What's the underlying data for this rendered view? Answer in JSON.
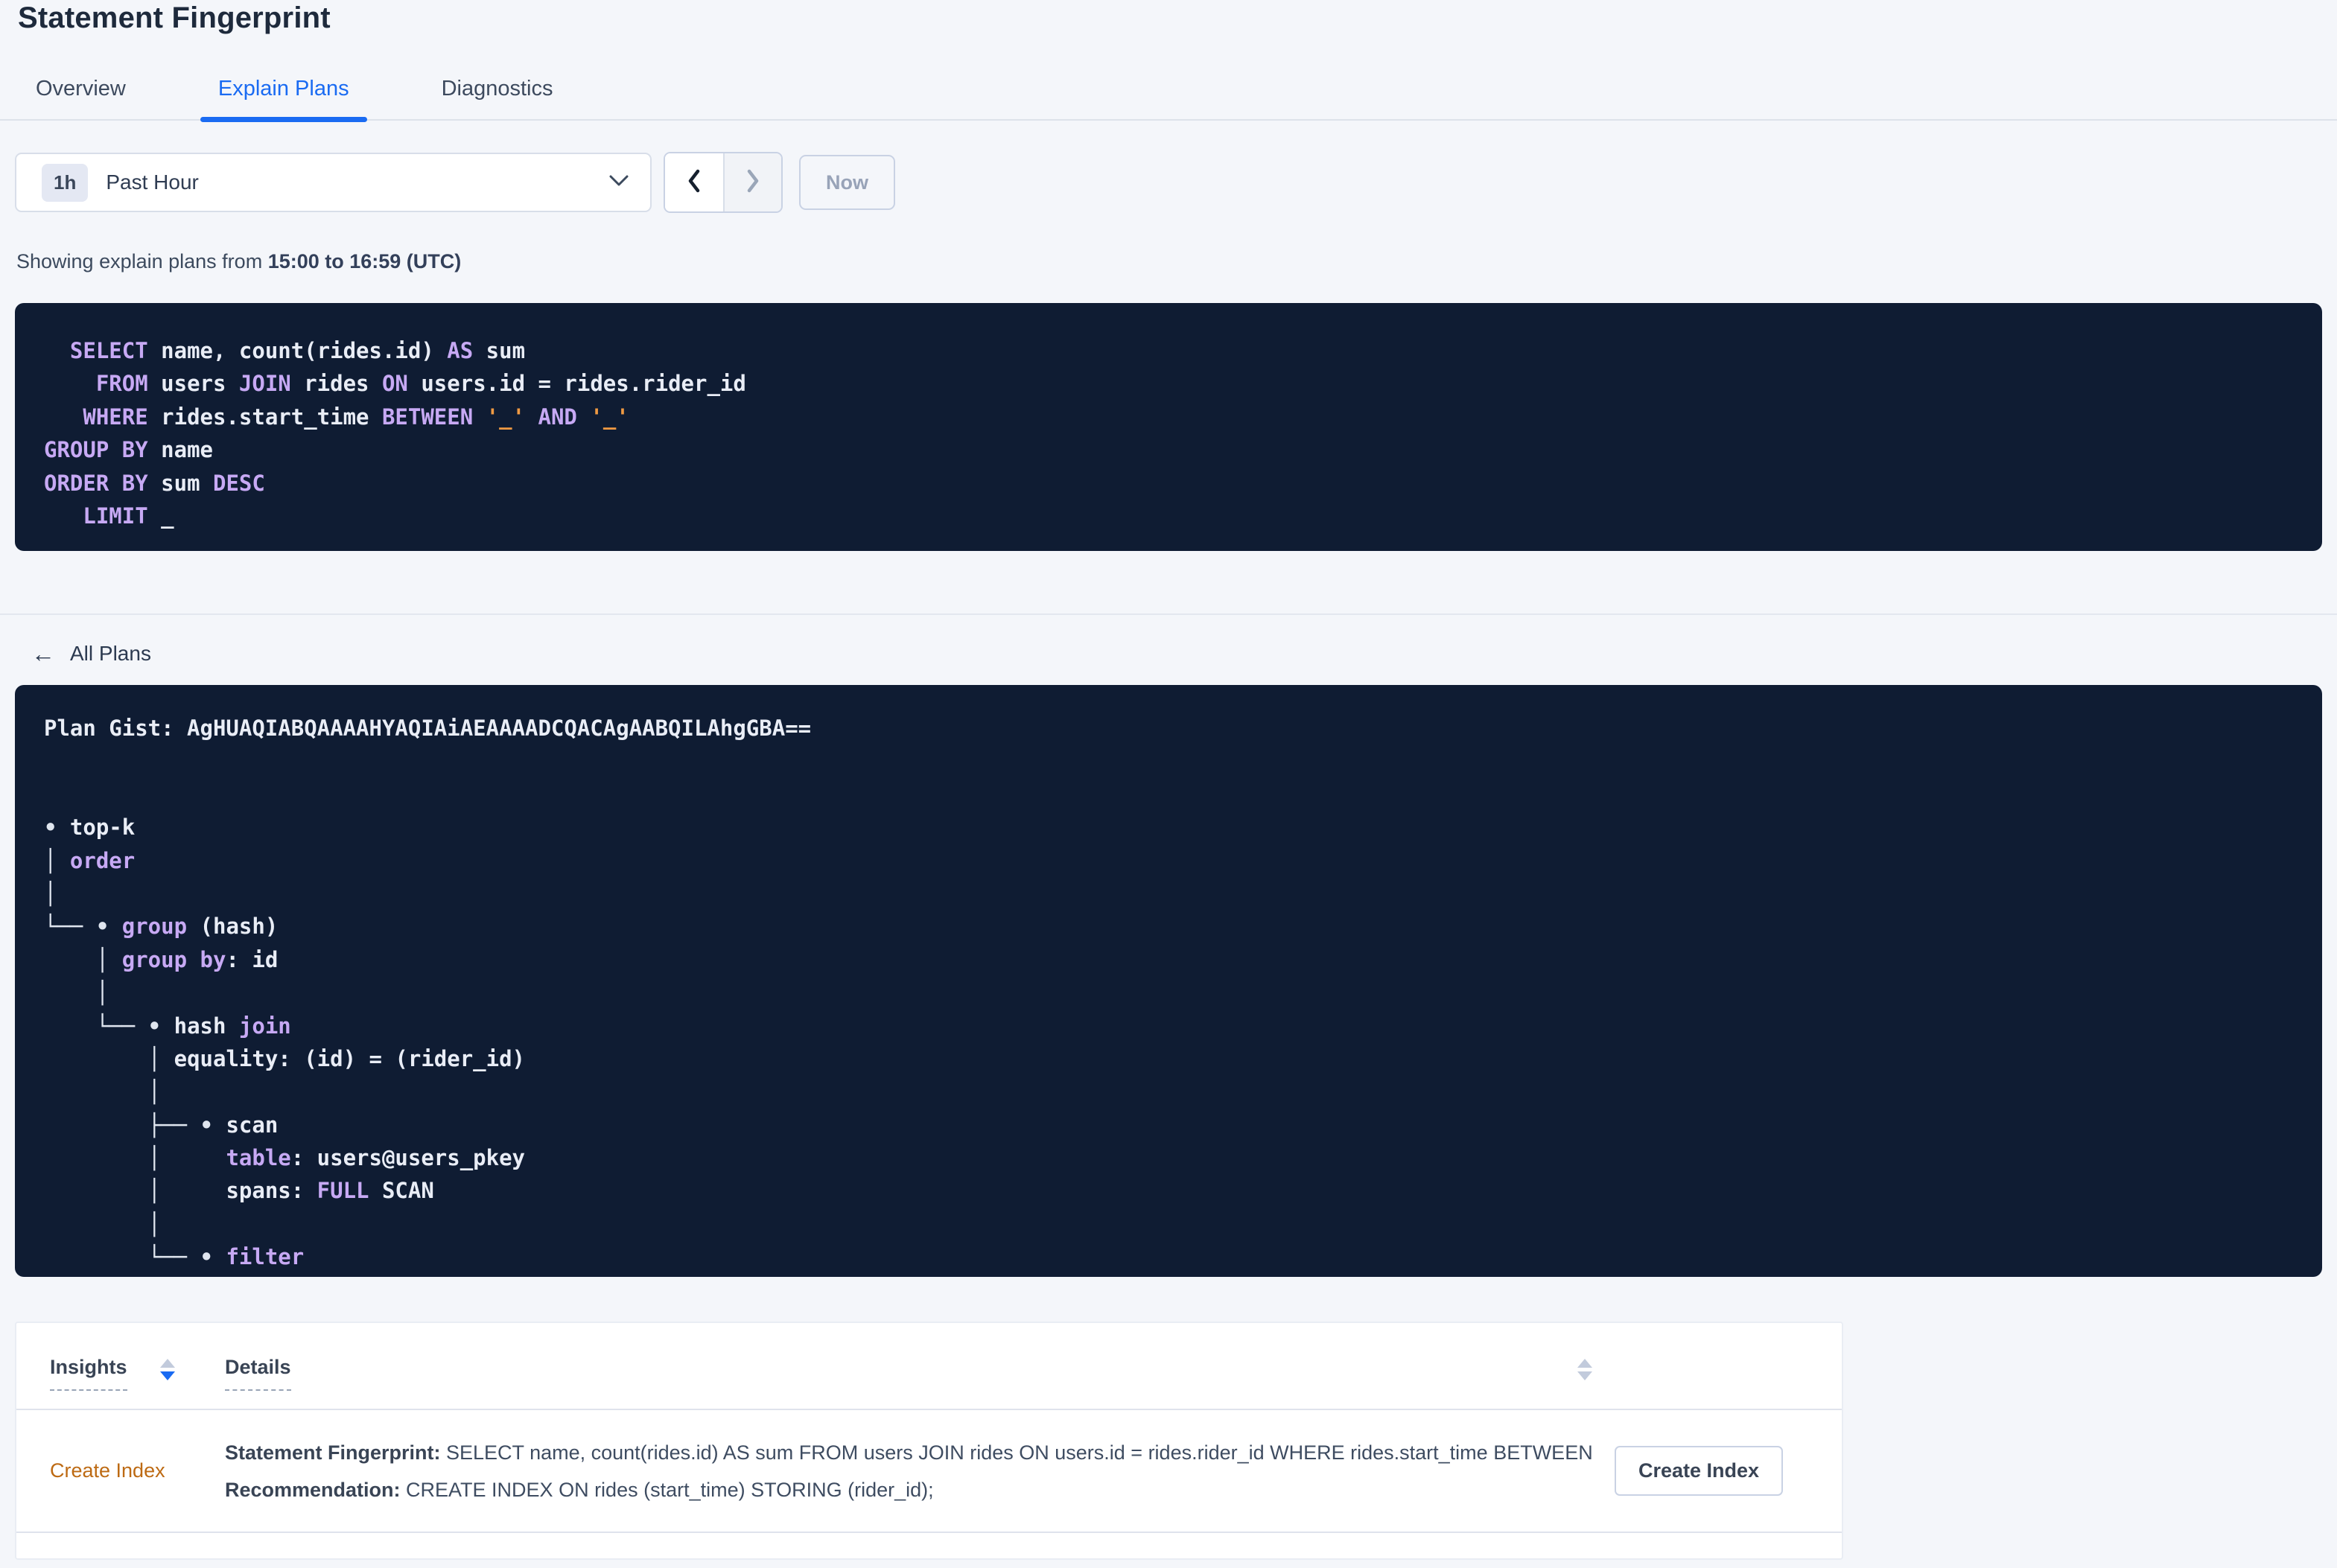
{
  "header": {
    "title": "Statement Fingerprint"
  },
  "tabs": [
    {
      "label": "Overview",
      "active": false
    },
    {
      "label": "Explain Plans",
      "active": true
    },
    {
      "label": "Diagnostics",
      "active": false
    }
  ],
  "time_picker": {
    "badge": "1h",
    "label": "Past Hour"
  },
  "pager": {
    "now_label": "Now"
  },
  "status_line": {
    "prefix": "Showing explain plans from ",
    "bold_range": "15:00 to 16:59 (UTC)"
  },
  "back_link": {
    "arrow": "←",
    "label": "All Plans"
  },
  "sql_block": {
    "lines": [
      [
        [
          "kw",
          "  SELECT"
        ],
        [
          "tx",
          " name, count(rides.id) "
        ],
        [
          "kw",
          "AS"
        ],
        [
          "tx",
          " sum"
        ]
      ],
      [
        [
          "kw",
          "    FROM"
        ],
        [
          "tx",
          " users "
        ],
        [
          "kw",
          "JOIN"
        ],
        [
          "tx",
          " rides "
        ],
        [
          "kw",
          "ON"
        ],
        [
          "tx",
          " users.id = rides.rider_id"
        ]
      ],
      [
        [
          "kw",
          "   WHERE"
        ],
        [
          "tx",
          " rides.start_time "
        ],
        [
          "kw",
          "BETWEEN"
        ],
        [
          "tx",
          " "
        ],
        [
          "lit",
          "'_'"
        ],
        [
          "tx",
          " "
        ],
        [
          "kw",
          "AND"
        ],
        [
          "tx",
          " "
        ],
        [
          "lit",
          "'_'"
        ]
      ],
      [
        [
          "kw",
          "GROUP BY"
        ],
        [
          "tx",
          " name"
        ]
      ],
      [
        [
          "kw",
          "ORDER BY"
        ],
        [
          "tx",
          " sum "
        ],
        [
          "kw",
          "DESC"
        ]
      ],
      [
        [
          "kw",
          "   LIMIT"
        ],
        [
          "tx",
          " _"
        ]
      ]
    ]
  },
  "gist_block": {
    "lines": [
      [
        [
          "tx",
          "Plan Gist: AgHUAQIABQAAAAHYAQIAiAEAAAADCQACAgAABQILAhgGBA=="
        ]
      ],
      [],
      [],
      [
        [
          "ln",
          "• "
        ],
        [
          "tx",
          "top-k"
        ]
      ],
      [
        [
          "ln",
          "│ "
        ],
        [
          "kw",
          "order"
        ]
      ],
      [
        [
          "ln",
          "│"
        ]
      ],
      [
        [
          "ln",
          "└── • "
        ],
        [
          "kw",
          "group"
        ],
        [
          "tx",
          " (hash)"
        ]
      ],
      [
        [
          "ln",
          "    │ "
        ],
        [
          "kw",
          "group by"
        ],
        [
          "tx",
          ": id"
        ]
      ],
      [
        [
          "ln",
          "    │"
        ]
      ],
      [
        [
          "ln",
          "    └── • "
        ],
        [
          "tx",
          "hash "
        ],
        [
          "kw",
          "join"
        ]
      ],
      [
        [
          "ln",
          "        │ "
        ],
        [
          "tx",
          "equality: (id) = (rider_id)"
        ]
      ],
      [
        [
          "ln",
          "        │"
        ]
      ],
      [
        [
          "ln",
          "        ├── • "
        ],
        [
          "tx",
          "scan"
        ]
      ],
      [
        [
          "ln",
          "        │     "
        ],
        [
          "kw",
          "table"
        ],
        [
          "tx",
          ": users@users_pkey"
        ]
      ],
      [
        [
          "ln",
          "        │     "
        ],
        [
          "tx",
          "spans: "
        ],
        [
          "kw",
          "FULL"
        ],
        [
          "tx",
          " SCAN"
        ]
      ],
      [
        [
          "ln",
          "        │"
        ]
      ],
      [
        [
          "ln",
          "        └── • "
        ],
        [
          "kw",
          "filter"
        ]
      ],
      [
        [
          "ln",
          "            │"
        ]
      ]
    ]
  },
  "insights_table": {
    "columns": [
      {
        "label": "Insights"
      },
      {
        "label": "Details"
      }
    ],
    "rows": [
      {
        "insight": "Create Index",
        "fingerprint_label": "Statement Fingerprint:",
        "fingerprint_text": " SELECT name, count(rides.id) AS sum FROM users JOIN rides ON users.id = rides.rider_id WHERE rides.start_time BETWEEN '_…",
        "recommendation_label": "Recommendation:",
        "recommendation_text": " CREATE INDEX ON rides (start_time) STORING (rider_id);",
        "action_label": "Create Index"
      }
    ]
  },
  "colors": {
    "accent_blue": "#1a6bf2",
    "code_background": "#0f1c33",
    "code_keyword": "#c7a9f4",
    "code_literal": "#f09a43",
    "insight_link_orange": "#bd6a13"
  }
}
